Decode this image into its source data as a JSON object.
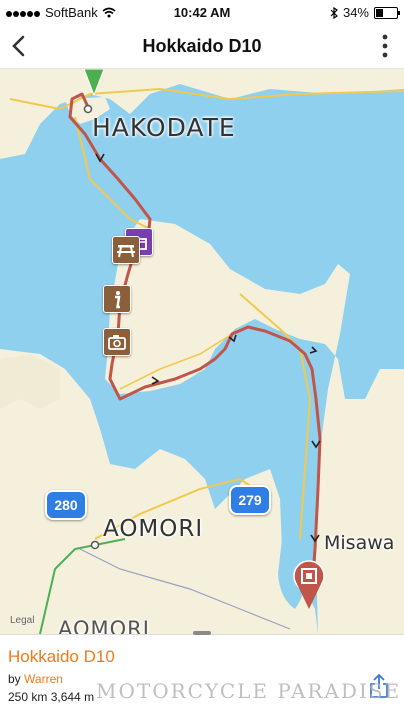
{
  "status_bar": {
    "carrier": "SoftBank",
    "time": "10:42 AM",
    "battery": "34%",
    "battery_level": 0.34,
    "icons": [
      "signal-dots-icon",
      "wifi-icon",
      "bluetooth-icon",
      "battery-icon"
    ]
  },
  "nav": {
    "title": "Hokkaido D10",
    "back_icon": "chevron-left-icon",
    "more_icon": "more-vertical-icon"
  },
  "map": {
    "labels": {
      "hakodate": "HAKODATE",
      "aomori_city": "AOMORI",
      "aomori_pref": "AOMORI",
      "misawa": "Misawa"
    },
    "road_badges": [
      "280",
      "279"
    ],
    "legal": "Legal",
    "colors": {
      "water": "#8fd0ee",
      "land": "#f5f0dc",
      "route": "#c0554a",
      "poi": "#8b5e3c",
      "poi_purple": "#7a3db0",
      "road_yellow": "#f2c94c",
      "road_badge": "#2f7ee6",
      "start_pin": "#4caf50",
      "end_pin": "#c0554a"
    },
    "pois": [
      "picnic-table-icon",
      "info-icon",
      "camera-icon",
      "gift-icon"
    ]
  },
  "route": {
    "title": "Hokkaido D10",
    "by_prefix": "by",
    "author": "Warren",
    "distance": "250 km",
    "elevation": "3,644 m",
    "share_icon": "share-icon"
  },
  "watermark": "MOTORCYCLE PARADISE"
}
